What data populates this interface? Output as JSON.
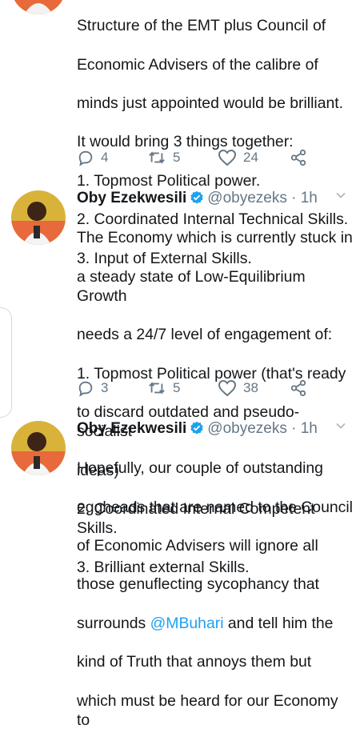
{
  "tweets": [
    {
      "lines": [
        "Structure of the EMT plus Council of",
        "Economic Advisers of the calibre of",
        "minds just appointed would be brilliant.",
        "It would bring 3 things together:",
        "1. Topmost Political power.",
        "2. Coordinated Internal Technical Skills.",
        "3. Input of External Skills."
      ],
      "replies": "4",
      "retweets": "5",
      "likes": "24"
    },
    {
      "name": "Oby Ezekwesili",
      "handle": "@obyezeks · 1h",
      "lines": [
        "The Economy which is currently stuck in",
        "a steady state of Low-Equilibrium Growth",
        "needs a 24/7 level of engagement of:",
        "1. Topmost Political power (that's ready",
        "to discard outdated and pseudo-socialist",
        "ideas)",
        "2. Coordinated Internal Competent Skills.",
        "3. Brilliant external Skills."
      ],
      "replies": "3",
      "retweets": "5",
      "likes": "38"
    },
    {
      "name": "Oby Ezekwesili",
      "handle": "@obyezeks · 1h",
      "lines_before": [
        "Hopefully, our couple of outstanding",
        "eggheads that are named to the Council",
        "of Economic Advisers will ignore all",
        "those genuflecting sycophancy that"
      ],
      "line_pre_mention": "surrounds ",
      "mention": "@MBuhari",
      "line_post_mention": " and tell him the",
      "lines_after": [
        "kind of Truth that annoys them but",
        "which must be heard for our Economy to"
      ]
    }
  ],
  "colors": {
    "accent": "#1da1f2",
    "muted": "#657786",
    "text": "#14171a"
  }
}
